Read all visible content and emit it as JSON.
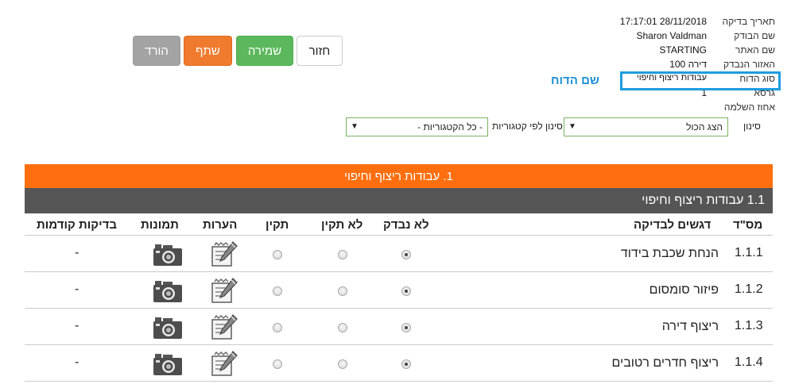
{
  "info": {
    "date_label": "תאריך בדיקה",
    "date_value": "17:17:01 28/11/2018",
    "inspector_label": "שם הבודק",
    "inspector_value": "Sharon Valdman",
    "site_label": "שם האתר",
    "site_value": "STARTING",
    "area_label": "האזור הנבדק",
    "area_value": "דירה 100",
    "report_type_label": "סוג הדוח",
    "report_type_value": "עבודות ריצוף וחיפוי",
    "version_label": "גרסא",
    "version_value": "1",
    "completion_label": "אחוז השלמה",
    "completion_value": ""
  },
  "report_name": "שם הדוח",
  "buttons": {
    "back": "חזור",
    "save": "שמירה",
    "share": "שתף",
    "download": "הורד"
  },
  "filter": {
    "label": "סינון",
    "show_value": "הצג הכול",
    "category_label": "סינון לפי קטגוריות",
    "category_value": "- כל הקטגוריות -"
  },
  "section": {
    "title": "1.  עבודות ריצוף וחיפוי",
    "subsection": "1.1  עבודות ריצוף וחיפוי"
  },
  "columns": {
    "num": "מס\"ד",
    "focus": "דגשים לבדיקה",
    "not_checked": "לא נבדק",
    "not_ok": "לא תקין",
    "ok": "תקין",
    "notes": "הערות",
    "photos": "תמונות",
    "previous": "בדיקות קודמות"
  },
  "rows": [
    {
      "num": "1.1.1",
      "desc": "הנחת שכבת בידוד",
      "selected": "not_checked",
      "previous": "-"
    },
    {
      "num": "1.1.2",
      "desc": "פיזור סומסום",
      "selected": "not_checked",
      "previous": "-"
    },
    {
      "num": "1.1.3",
      "desc": "ריצוף דירה",
      "selected": "not_checked",
      "previous": "-"
    },
    {
      "num": "1.1.4",
      "desc": "ריצוף חדרים רטובים",
      "selected": "not_checked",
      "previous": "-"
    }
  ],
  "colors": {
    "accent_orange": "#ff6f0f",
    "subsection_gray": "#555555",
    "save_green": "#5cb85c",
    "share_orange": "#f07b2e",
    "download_gray": "#a3a3a3",
    "report_name_blue": "#1a8fd6",
    "highlight_blue": "#1e9ce0"
  },
  "icons": {
    "notes": "notepad-pencil-icon",
    "photos": "camera-icon",
    "dropdown": "triangle-down-icon"
  }
}
